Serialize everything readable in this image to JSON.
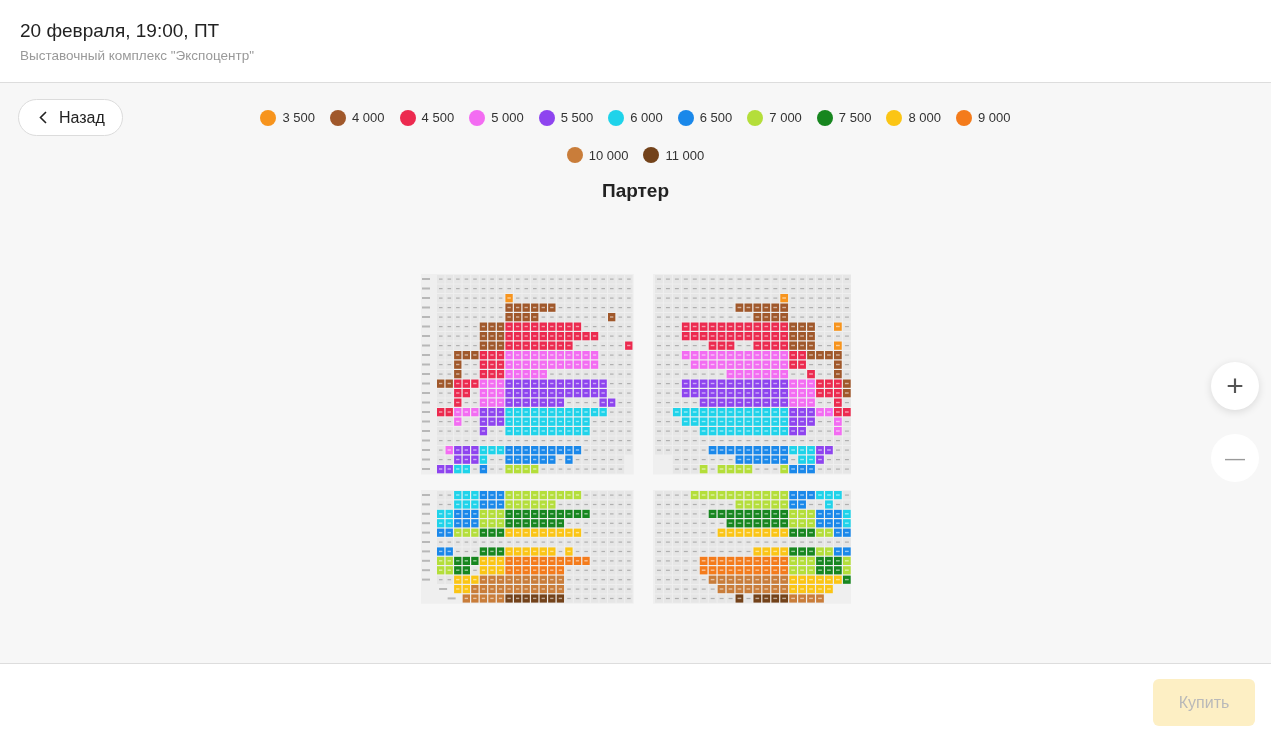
{
  "header": {
    "title": "20 февраля, 19:00, ПТ",
    "subtitle": "Выставочный комплекс \"Экспоцентр\""
  },
  "back_button": {
    "label": "Назад"
  },
  "legend": [
    {
      "label": "3 500",
      "color": "#f7941d"
    },
    {
      "label": "4 000",
      "color": "#a0582b"
    },
    {
      "label": "4 500",
      "color": "#ec2a4f"
    },
    {
      "label": "5 000",
      "color": "#f36cf2"
    },
    {
      "label": "5 500",
      "color": "#8e44ef"
    },
    {
      "label": "6 000",
      "color": "#1fd3ea"
    },
    {
      "label": "6 500",
      "color": "#1a88ea"
    },
    {
      "label": "7 000",
      "color": "#b4de3a"
    },
    {
      "label": "7 500",
      "color": "#17861f"
    },
    {
      "label": "8 000",
      "color": "#fbc515"
    },
    {
      "label": "9 000",
      "color": "#f47b1b"
    },
    {
      "label": "10 000",
      "color": "#c97d3a"
    },
    {
      "label": "11 000",
      "color": "#73421a"
    }
  ],
  "hall": {
    "title": "Партер"
  },
  "zoom_in": {
    "label": "+",
    "disabled": false
  },
  "zoom_out": {
    "label": "—",
    "disabled": true
  },
  "buy_button": {
    "label": "Купить",
    "disabled": true
  }
}
